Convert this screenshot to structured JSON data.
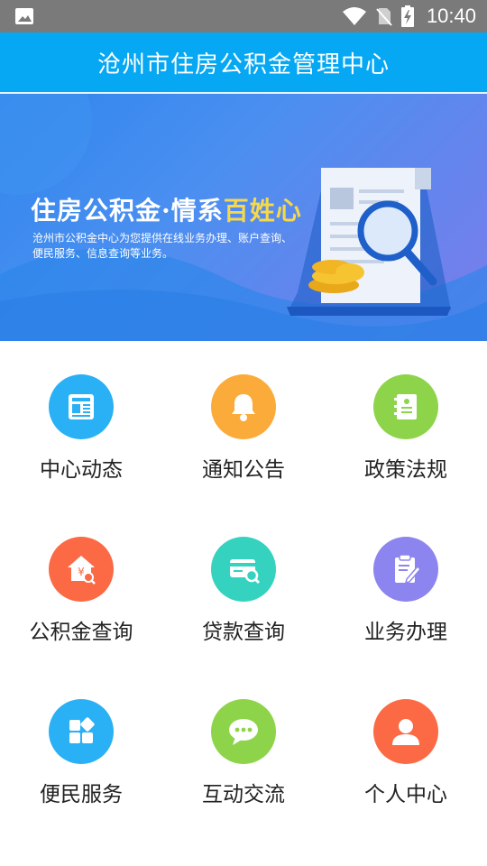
{
  "status_bar": {
    "time": "10:40"
  },
  "app_bar": {
    "title": "沧州市住房公积金管理中心"
  },
  "banner": {
    "headline_main": "住房公积金·情系",
    "headline_highlight": "百姓心",
    "description": "沧州市公积金中心为您提供在线业务办理、账户查询、便民服务、信息查询等业务。"
  },
  "menu": [
    {
      "label": "中心动态",
      "icon": "news-icon",
      "color": "#2ab0f5"
    },
    {
      "label": "通知公告",
      "icon": "bell-icon",
      "color": "#fbab3a"
    },
    {
      "label": "政策法规",
      "icon": "policy-book-icon",
      "color": "#8ed44a"
    },
    {
      "label": "公积金查询",
      "icon": "house-yuan-search-icon",
      "color": "#fb6a45"
    },
    {
      "label": "贷款查询",
      "icon": "card-search-icon",
      "color": "#35d3bf"
    },
    {
      "label": "业务办理",
      "icon": "clipboard-edit-icon",
      "color": "#8d85ef"
    },
    {
      "label": "便民服务",
      "icon": "apps-icon",
      "color": "#2ab0f5"
    },
    {
      "label": "互动交流",
      "icon": "chat-bubble-icon",
      "color": "#8ed44a"
    },
    {
      "label": "个人中心",
      "icon": "person-icon",
      "color": "#fb6a45"
    }
  ]
}
